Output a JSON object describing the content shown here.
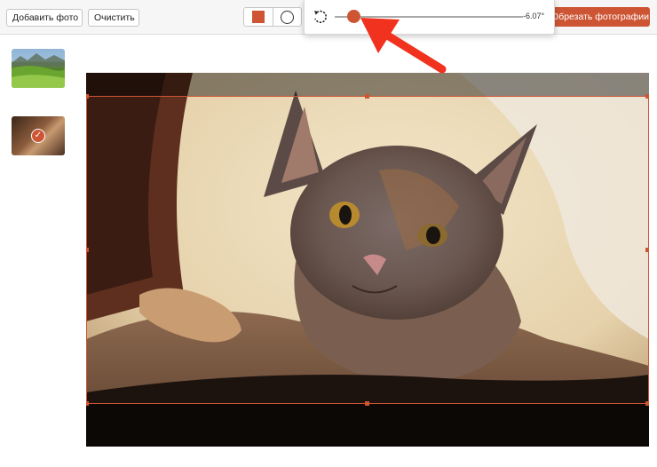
{
  "toolbar": {
    "add_photo_label": "Добавить фото",
    "clear_label": "Очистить",
    "crop_label": "Обрезать фотографии"
  },
  "rotate": {
    "angle_text": "-6.07°",
    "slider_position": 0.1
  },
  "sidebar": {
    "thumbnails": [
      {
        "name": "landscape",
        "selected": false
      },
      {
        "name": "cat",
        "selected": true
      }
    ]
  },
  "colors": {
    "accent": "#cd5534",
    "annotation_arrow": "#f0321e"
  },
  "icons": [
    "rotate-icon",
    "square-shape-icon",
    "circle-shape-icon",
    "checkmark-icon",
    "annotation-arrow"
  ]
}
